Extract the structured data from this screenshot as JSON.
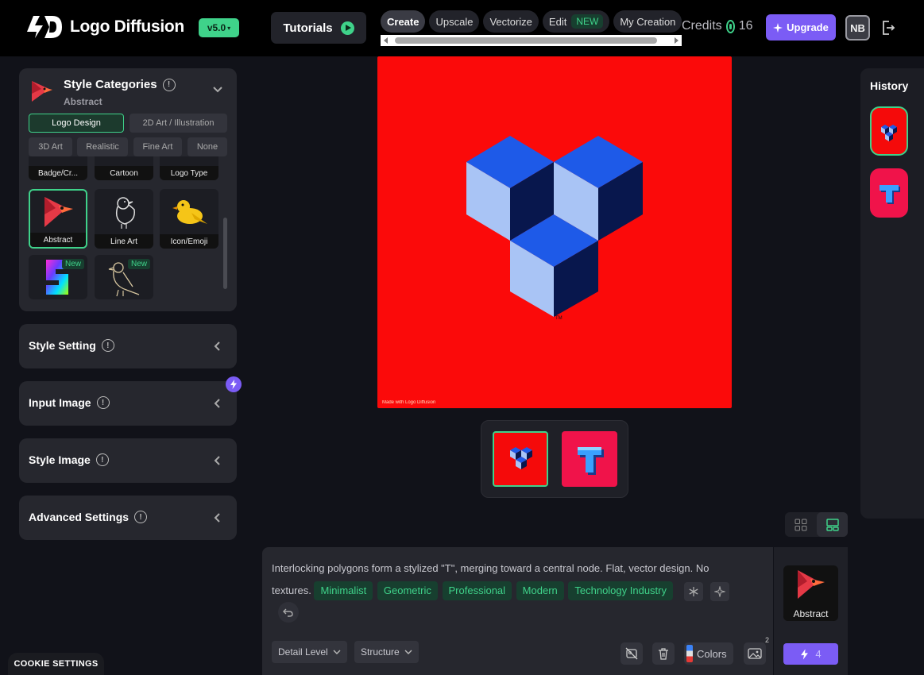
{
  "app": {
    "name": "Logo Diffusion",
    "version": "v5.0"
  },
  "header": {
    "tutorials_label": "Tutorials",
    "nav_tabs": [
      {
        "label": "Create",
        "active": true
      },
      {
        "label": "Upscale"
      },
      {
        "label": "Vectorize"
      },
      {
        "label": "Edit",
        "badge": "NEW"
      },
      {
        "label": "My Creation"
      }
    ],
    "credits_label": "Credits",
    "credits_value": "16",
    "upgrade_label": "Upgrade",
    "avatar_initials": "NB"
  },
  "style_categories": {
    "title": "Style Categories",
    "selected": "Abstract",
    "segments": [
      "Logo Design",
      "2D Art / Illustration",
      "3D Art",
      "Realistic",
      "Fine Art",
      "None"
    ],
    "active_segment": "Logo Design",
    "tiles": [
      {
        "label": "Badge/Cr..."
      },
      {
        "label": "Cartoon"
      },
      {
        "label": "Logo Type"
      },
      {
        "label": "Abstract",
        "selected": true
      },
      {
        "label": "Line Art"
      },
      {
        "label": "Icon/Emoji"
      },
      {
        "label": "",
        "badge": "New"
      },
      {
        "label": "",
        "badge": "New"
      }
    ]
  },
  "accordions": [
    {
      "label": "Style Setting"
    },
    {
      "label": "Input Image"
    },
    {
      "label": "Style Image"
    },
    {
      "label": "Advanced Settings"
    }
  ],
  "canvas": {
    "watermark": "Made with  Logo Diffusion",
    "tm": "TM"
  },
  "history": {
    "title": "History"
  },
  "prompt": {
    "text": "Interlocking polygons form a stylized \"T\", merging toward a central node. Flat, vector design. No textures.",
    "tags": [
      "Minimalist",
      "Geometric",
      "Professional",
      "Modern",
      "Technology Industry"
    ],
    "detail_level": "Detail Level",
    "structure": "Structure",
    "colors_label": "Colors",
    "image_count": "2"
  },
  "style_card": {
    "label": "Abstract"
  },
  "generate": {
    "count": "4"
  },
  "cookie_label": "COOKIE SETTINGS",
  "colors": {
    "accent_green": "#3fd28a",
    "accent_purple": "#7b5cf5",
    "canvas_red": "#fb0a0a"
  }
}
